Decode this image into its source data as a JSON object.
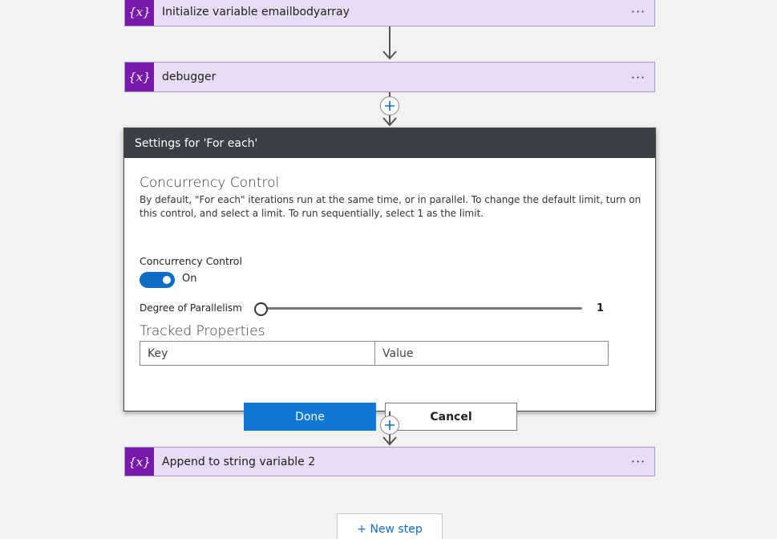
{
  "actions": [
    {
      "icon_text": "{x}",
      "title": "Initialize variable emailbodyarray",
      "menu": "···"
    },
    {
      "icon_text": "{x}",
      "title": "debugger",
      "menu": "···"
    },
    {
      "icon_text": "{x}",
      "title": "Append to string variable 2",
      "menu": "···"
    }
  ],
  "settings": {
    "header": "Settings for 'For each'",
    "concurrency_title": "Concurrency Control",
    "description": "By default, \"For each\" iterations run at the same time, or in parallel. To change the default limit, turn on this control, and select a limit. To run sequentially, select 1 as the limit.",
    "concurrency_label": "Concurrency Control",
    "toggle_state": "On",
    "parallelism_label": "Degree of Parallelism",
    "parallelism_value": "1",
    "tracked_title": "Tracked Properties",
    "key_placeholder": "Key",
    "value_placeholder": "Value",
    "done_label": "Done",
    "cancel_label": "Cancel"
  },
  "new_step_label": "+ New step",
  "icons": [
    "variable-icon",
    "more-options-icon",
    "add-step-icon",
    "arrow-down-icon"
  ],
  "colors": {
    "variable_accent": "#7719aa",
    "card_bg": "#e8dcf5",
    "primary": "#0f78d4",
    "header_bg": "#3b3f47"
  }
}
